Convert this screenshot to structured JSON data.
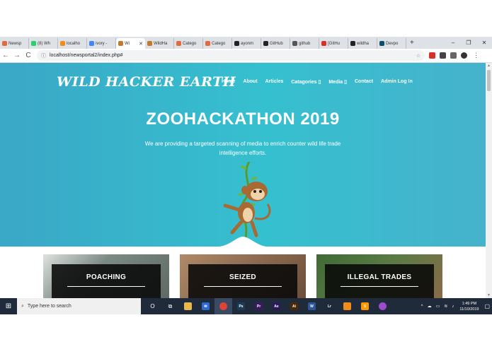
{
  "browser": {
    "tabs": [
      {
        "label": "Newsp",
        "icon": "newsportal-favicon",
        "color": "#e06c3c"
      },
      {
        "label": "(8) Wh",
        "icon": "whatsapp-favicon",
        "color": "#25d366"
      },
      {
        "label": "localho",
        "icon": "xampp-favicon",
        "color": "#f08c1c"
      },
      {
        "label": "ivory -",
        "icon": "google-favicon",
        "color": "#4285f4"
      },
      {
        "label": "Wi",
        "icon": "wildhacker-favicon",
        "color": "#c47a2c",
        "active": true
      },
      {
        "label": "WildHa",
        "icon": "wildhacker-favicon",
        "color": "#c47a2c"
      },
      {
        "label": "Catego",
        "icon": "newsportal-favicon",
        "color": "#e06c3c"
      },
      {
        "label": "Catego",
        "icon": "newsportal-favicon",
        "color": "#e06c3c"
      },
      {
        "label": "ayonm",
        "icon": "github-favicon",
        "color": "#222"
      },
      {
        "label": "GitHub",
        "icon": "github-favicon",
        "color": "#222"
      },
      {
        "label": "github",
        "icon": "github-favicon",
        "color": "#555"
      },
      {
        "label": "[GitHu",
        "icon": "gmail-favicon",
        "color": "#d93025"
      },
      {
        "label": "wildha",
        "icon": "github-favicon",
        "color": "#222"
      },
      {
        "label": "Devpo",
        "icon": "devpost-favicon",
        "color": "#0b4f6c"
      }
    ],
    "new_tab": "+",
    "window_controls": {
      "minimize": "–",
      "restore": "❐",
      "close": "✕"
    },
    "nav": {
      "back": "←",
      "forward": "→",
      "reload": "C"
    },
    "url": "localhost/newsportal2/index.php#",
    "extensions": [
      {
        "icon": "star-icon",
        "color": "#777"
      },
      {
        "icon": "ext-red-icon",
        "color": "#d93025"
      },
      {
        "icon": "ext-cloud-icon",
        "color": "#444"
      },
      {
        "icon": "ext-cart-icon",
        "color": "#666"
      },
      {
        "icon": "profile-avatar-icon",
        "color": "#333"
      }
    ],
    "menu": "⋮"
  },
  "site": {
    "brand": "WILD HACKER EARTH",
    "nav": [
      {
        "label": "Home"
      },
      {
        "label": "About"
      },
      {
        "label": "Articles"
      },
      {
        "label": "Catagories ▯"
      },
      {
        "label": "Media ▯"
      },
      {
        "label": "Contact"
      },
      {
        "label": "Admin Log In"
      }
    ],
    "hero": {
      "title": "ZOOHACKATHON 2019",
      "subtitle": "We are providing a targeted scanning of media to enrich counter wild life trade intelligence efforts."
    },
    "cards": [
      {
        "title": "POACHING",
        "bg": "#7c8a84"
      },
      {
        "title": "SEIZED",
        "bg": "#8b6a52"
      },
      {
        "title": "ILLEGAL TRADES",
        "bg": "#5c7a46"
      }
    ]
  },
  "taskbar": {
    "start_icon": "windows-start-icon",
    "search_placeholder": "Type here to search",
    "apps": [
      {
        "icon": "cortana-icon",
        "label": "O",
        "color": "transparent"
      },
      {
        "icon": "task-view-icon",
        "label": "⧉",
        "color": "transparent"
      },
      {
        "icon": "file-explorer-icon",
        "label": "",
        "color": "#e8b84a"
      },
      {
        "icon": "mail-icon",
        "label": "✉",
        "color": "#2e6bd1"
      },
      {
        "icon": "chrome-icon",
        "label": "",
        "color": "#db4437",
        "active": true
      },
      {
        "icon": "photoshop-icon",
        "label": "Ps",
        "color": "#1c3b57"
      },
      {
        "icon": "premiere-icon",
        "label": "Pr",
        "color": "#3a1a5e"
      },
      {
        "icon": "after-effects-icon",
        "label": "Ae",
        "color": "#2a1a5a"
      },
      {
        "icon": "illustrator-icon",
        "label": "Ai",
        "color": "#4a2a06"
      },
      {
        "icon": "word-icon",
        "label": "W",
        "color": "#2b579a"
      },
      {
        "icon": "lightroom-icon",
        "label": "Lr",
        "color": "#1d2b3d"
      },
      {
        "icon": "xampp-icon",
        "label": "",
        "color": "#f08c1c"
      },
      {
        "icon": "sublime-icon",
        "label": "S",
        "color": "#ff9800"
      },
      {
        "icon": "app-purple-icon",
        "label": "",
        "color": "#9c4dcc"
      }
    ],
    "tray": {
      "time": "1:49 PM",
      "date": "11/10/2019"
    }
  }
}
